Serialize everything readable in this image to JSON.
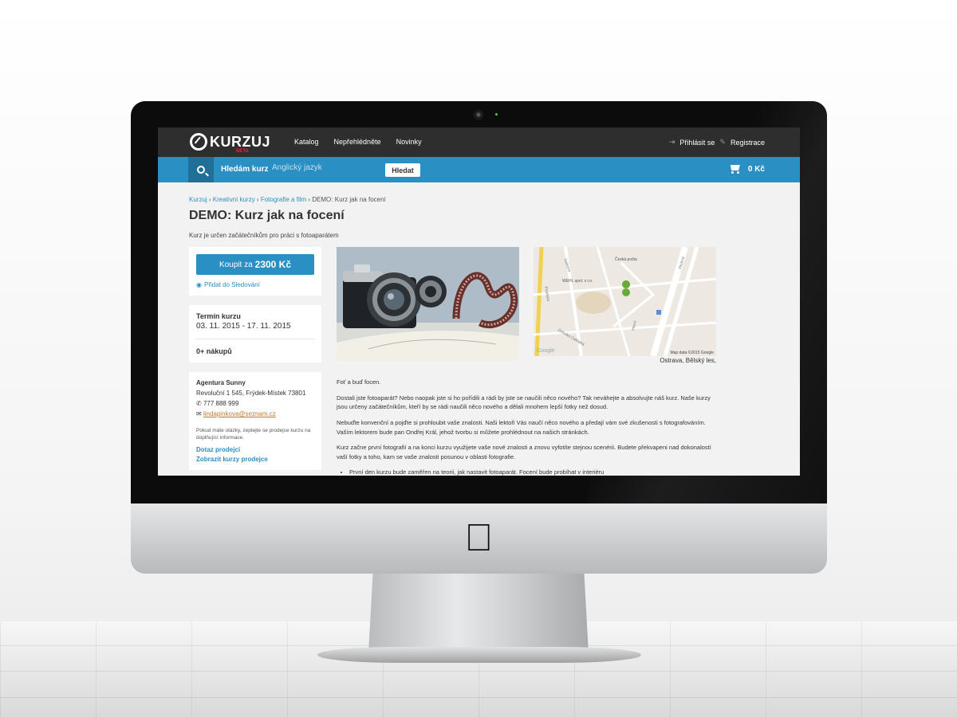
{
  "header": {
    "logo_text": "KURZUJ",
    "logo_badge": "BETA",
    "nav": [
      "Katalog",
      "Nepřehlédněte",
      "Novinky"
    ],
    "login": "Přihlásit se",
    "register": "Registrace"
  },
  "search": {
    "label": "Hledám kurz",
    "placeholder": "Anglický jazyk",
    "button": "Hledat",
    "cart_total": "0 Kč"
  },
  "breadcrumb": {
    "items": [
      "Kurzuj",
      "Kreativní kurzy",
      "Fotografie a film"
    ],
    "current": "DEMO: Kurz jak na focení"
  },
  "course": {
    "title": "DEMO: Kurz jak na focení",
    "subtitle": "Kurz je určen začátečníkům pro práci s fotoaparátem",
    "buy_prefix": "Koupit za",
    "buy_price": "2300 Kč",
    "watch_label": "Přidat do Sledování",
    "term_label": "Termín kurzu",
    "term_value": "03. 11. 2015 - 17. 11. 2015",
    "purchases": "0+ nákupů"
  },
  "seller": {
    "name": "Agentura Sunny",
    "address": "Revoluční 1 545, Frýdek-Místek 73801",
    "phone": "777 888 999",
    "email": "lindapinkova@seznam.cz",
    "note": "Pokud máte otázky, zeptejte se prodejce kurzu na doplňující informace.",
    "link_ask": "Dotaz prodejci",
    "link_courses": "Zobrazit kurzy prodejce"
  },
  "map": {
    "labels": [
      "Česká pošta",
      "WEHL spol. s r.o.",
      "Pizelska",
      "Hlubna",
      "Zelenka Cahlaba",
      "Valkova",
      "Horní"
    ],
    "credit": "Map data ©2015 Google",
    "google": "Google",
    "caption": "Ostrava, Bělský les,"
  },
  "description": {
    "p1": "Foť a buď focen.",
    "p2": "Dostali jste fotoaparát? Nebo naopak jste si ho pořídili a rádi by jste se naučili něco nového? Tak neváhejte a absolvujte náš kurz. Naše kurzy jsou určeny začátečníkům, kteří by se rádi naučili něco nového a dělali mnohem lepší fotky než dosud.",
    "p3": "Nebuďte konvenční a pojďte si prohloubit vaše znalosti. Naši lektoři Vás naučí něco nového a předají vám své zkušenosti s fotografováním. Vaším lektorem bude pan Ondřej Král, jehož tvorbu si můžete prohlédnout na našich stránkách.",
    "p4": "Kurz začne první fotografií a na konci kurzu využijete vaše nové znalosti a znovu vyfotíte stejnou scenérii. Budete překvapeni nad dokonalostí vaší fotky a toho, kam se vaše znalosti posunou v oblasti fotografie.",
    "bullet1": "První den kurzu bude zaměřen na teorii, jak nastavit fotoaparát. Focení bude probíhat v interiéru"
  },
  "colors": {
    "accent": "#2a8fc3",
    "topbar": "#2e2e2e",
    "link_email": "#c07b2c"
  }
}
